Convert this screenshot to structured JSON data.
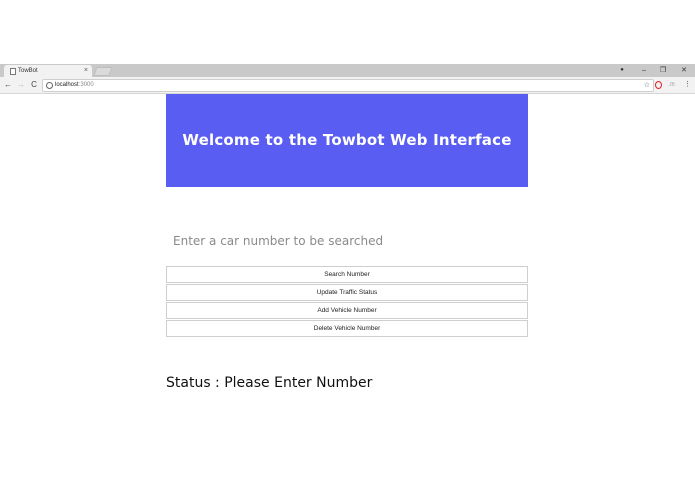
{
  "browser": {
    "tab_title": "TowBot",
    "tab_close": "×",
    "url_host": "localhost",
    "url_port": ":3000",
    "controls": {
      "profile": "●",
      "minimize": "–",
      "restore": "❐",
      "close": "✕"
    },
    "nav": {
      "back": "←",
      "forward": "→",
      "reload": "C"
    },
    "star": "☆",
    "ext_jb": "JB",
    "menu": "⋮"
  },
  "page": {
    "banner_title": "Welcome to the Towbot Web Interface",
    "search_placeholder": "Enter a car number to be searched",
    "search_value": "",
    "buttons": {
      "search": "Search Number",
      "update_traffic": "Update Traffic Status",
      "add_vehicle": "Add Vehicle Number",
      "delete_vehicle": "Delete Vehicle Number"
    },
    "status_label": "Status : Please Enter Number"
  },
  "colors": {
    "banner": "#5a5df2",
    "banner_text": "#ffffff"
  }
}
